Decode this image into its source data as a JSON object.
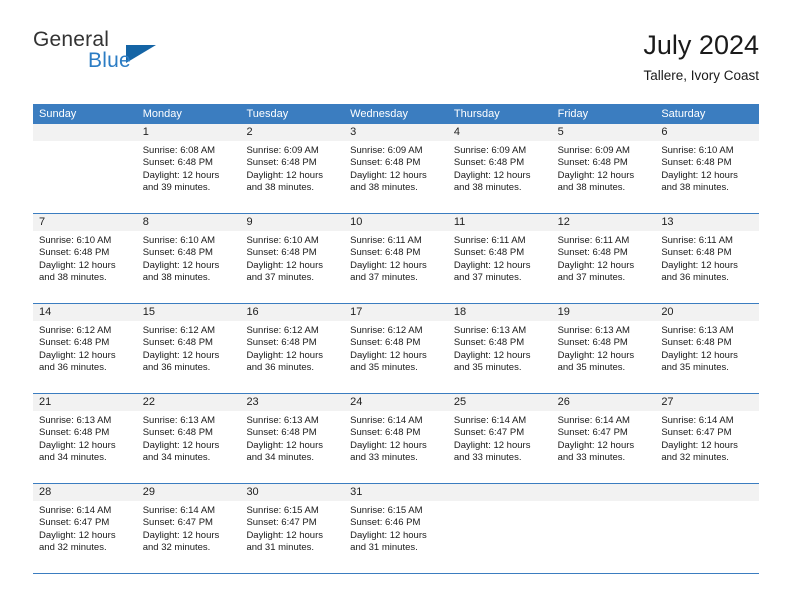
{
  "logo": {
    "word_top": "General",
    "word_bottom": "Blue",
    "triangle_icon": "logo-triangle-icon",
    "colors": {
      "general_text": "#333333",
      "blue_text": "#2b7cc4",
      "triangle": "#1464a5"
    }
  },
  "header": {
    "title": "July 2024",
    "subtitle": "Tallere, Ivory Coast"
  },
  "theme": {
    "header_blue": "#3b7dc0",
    "daynum_bg": "#f2f2f2",
    "cell_bg": "#ffffff"
  },
  "weekdays": [
    "Sunday",
    "Monday",
    "Tuesday",
    "Wednesday",
    "Thursday",
    "Friday",
    "Saturday"
  ],
  "weeks": [
    [
      {
        "day": "",
        "empty": true,
        "sunrise": "",
        "sunset": "",
        "daylight_1": "",
        "daylight_2": ""
      },
      {
        "day": "1",
        "sunrise": "Sunrise: 6:08 AM",
        "sunset": "Sunset: 6:48 PM",
        "daylight_1": "Daylight: 12 hours",
        "daylight_2": "and 39 minutes."
      },
      {
        "day": "2",
        "sunrise": "Sunrise: 6:09 AM",
        "sunset": "Sunset: 6:48 PM",
        "daylight_1": "Daylight: 12 hours",
        "daylight_2": "and 38 minutes."
      },
      {
        "day": "3",
        "sunrise": "Sunrise: 6:09 AM",
        "sunset": "Sunset: 6:48 PM",
        "daylight_1": "Daylight: 12 hours",
        "daylight_2": "and 38 minutes."
      },
      {
        "day": "4",
        "sunrise": "Sunrise: 6:09 AM",
        "sunset": "Sunset: 6:48 PM",
        "daylight_1": "Daylight: 12 hours",
        "daylight_2": "and 38 minutes."
      },
      {
        "day": "5",
        "sunrise": "Sunrise: 6:09 AM",
        "sunset": "Sunset: 6:48 PM",
        "daylight_1": "Daylight: 12 hours",
        "daylight_2": "and 38 minutes."
      },
      {
        "day": "6",
        "sunrise": "Sunrise: 6:10 AM",
        "sunset": "Sunset: 6:48 PM",
        "daylight_1": "Daylight: 12 hours",
        "daylight_2": "and 38 minutes."
      }
    ],
    [
      {
        "day": "7",
        "sunrise": "Sunrise: 6:10 AM",
        "sunset": "Sunset: 6:48 PM",
        "daylight_1": "Daylight: 12 hours",
        "daylight_2": "and 38 minutes."
      },
      {
        "day": "8",
        "sunrise": "Sunrise: 6:10 AM",
        "sunset": "Sunset: 6:48 PM",
        "daylight_1": "Daylight: 12 hours",
        "daylight_2": "and 38 minutes."
      },
      {
        "day": "9",
        "sunrise": "Sunrise: 6:10 AM",
        "sunset": "Sunset: 6:48 PM",
        "daylight_1": "Daylight: 12 hours",
        "daylight_2": "and 37 minutes."
      },
      {
        "day": "10",
        "sunrise": "Sunrise: 6:11 AM",
        "sunset": "Sunset: 6:48 PM",
        "daylight_1": "Daylight: 12 hours",
        "daylight_2": "and 37 minutes."
      },
      {
        "day": "11",
        "sunrise": "Sunrise: 6:11 AM",
        "sunset": "Sunset: 6:48 PM",
        "daylight_1": "Daylight: 12 hours",
        "daylight_2": "and 37 minutes."
      },
      {
        "day": "12",
        "sunrise": "Sunrise: 6:11 AM",
        "sunset": "Sunset: 6:48 PM",
        "daylight_1": "Daylight: 12 hours",
        "daylight_2": "and 37 minutes."
      },
      {
        "day": "13",
        "sunrise": "Sunrise: 6:11 AM",
        "sunset": "Sunset: 6:48 PM",
        "daylight_1": "Daylight: 12 hours",
        "daylight_2": "and 36 minutes."
      }
    ],
    [
      {
        "day": "14",
        "sunrise": "Sunrise: 6:12 AM",
        "sunset": "Sunset: 6:48 PM",
        "daylight_1": "Daylight: 12 hours",
        "daylight_2": "and 36 minutes."
      },
      {
        "day": "15",
        "sunrise": "Sunrise: 6:12 AM",
        "sunset": "Sunset: 6:48 PM",
        "daylight_1": "Daylight: 12 hours",
        "daylight_2": "and 36 minutes."
      },
      {
        "day": "16",
        "sunrise": "Sunrise: 6:12 AM",
        "sunset": "Sunset: 6:48 PM",
        "daylight_1": "Daylight: 12 hours",
        "daylight_2": "and 36 minutes."
      },
      {
        "day": "17",
        "sunrise": "Sunrise: 6:12 AM",
        "sunset": "Sunset: 6:48 PM",
        "daylight_1": "Daylight: 12 hours",
        "daylight_2": "and 35 minutes."
      },
      {
        "day": "18",
        "sunrise": "Sunrise: 6:13 AM",
        "sunset": "Sunset: 6:48 PM",
        "daylight_1": "Daylight: 12 hours",
        "daylight_2": "and 35 minutes."
      },
      {
        "day": "19",
        "sunrise": "Sunrise: 6:13 AM",
        "sunset": "Sunset: 6:48 PM",
        "daylight_1": "Daylight: 12 hours",
        "daylight_2": "and 35 minutes."
      },
      {
        "day": "20",
        "sunrise": "Sunrise: 6:13 AM",
        "sunset": "Sunset: 6:48 PM",
        "daylight_1": "Daylight: 12 hours",
        "daylight_2": "and 35 minutes."
      }
    ],
    [
      {
        "day": "21",
        "sunrise": "Sunrise: 6:13 AM",
        "sunset": "Sunset: 6:48 PM",
        "daylight_1": "Daylight: 12 hours",
        "daylight_2": "and 34 minutes."
      },
      {
        "day": "22",
        "sunrise": "Sunrise: 6:13 AM",
        "sunset": "Sunset: 6:48 PM",
        "daylight_1": "Daylight: 12 hours",
        "daylight_2": "and 34 minutes."
      },
      {
        "day": "23",
        "sunrise": "Sunrise: 6:13 AM",
        "sunset": "Sunset: 6:48 PM",
        "daylight_1": "Daylight: 12 hours",
        "daylight_2": "and 34 minutes."
      },
      {
        "day": "24",
        "sunrise": "Sunrise: 6:14 AM",
        "sunset": "Sunset: 6:48 PM",
        "daylight_1": "Daylight: 12 hours",
        "daylight_2": "and 33 minutes."
      },
      {
        "day": "25",
        "sunrise": "Sunrise: 6:14 AM",
        "sunset": "Sunset: 6:47 PM",
        "daylight_1": "Daylight: 12 hours",
        "daylight_2": "and 33 minutes."
      },
      {
        "day": "26",
        "sunrise": "Sunrise: 6:14 AM",
        "sunset": "Sunset: 6:47 PM",
        "daylight_1": "Daylight: 12 hours",
        "daylight_2": "and 33 minutes."
      },
      {
        "day": "27",
        "sunrise": "Sunrise: 6:14 AM",
        "sunset": "Sunset: 6:47 PM",
        "daylight_1": "Daylight: 12 hours",
        "daylight_2": "and 32 minutes."
      }
    ],
    [
      {
        "day": "28",
        "sunrise": "Sunrise: 6:14 AM",
        "sunset": "Sunset: 6:47 PM",
        "daylight_1": "Daylight: 12 hours",
        "daylight_2": "and 32 minutes."
      },
      {
        "day": "29",
        "sunrise": "Sunrise: 6:14 AM",
        "sunset": "Sunset: 6:47 PM",
        "daylight_1": "Daylight: 12 hours",
        "daylight_2": "and 32 minutes."
      },
      {
        "day": "30",
        "sunrise": "Sunrise: 6:15 AM",
        "sunset": "Sunset: 6:47 PM",
        "daylight_1": "Daylight: 12 hours",
        "daylight_2": "and 31 minutes."
      },
      {
        "day": "31",
        "sunrise": "Sunrise: 6:15 AM",
        "sunset": "Sunset: 6:46 PM",
        "daylight_1": "Daylight: 12 hours",
        "daylight_2": "and 31 minutes."
      },
      {
        "day": "",
        "empty": true,
        "sunrise": "",
        "sunset": "",
        "daylight_1": "",
        "daylight_2": ""
      },
      {
        "day": "",
        "empty": true,
        "sunrise": "",
        "sunset": "",
        "daylight_1": "",
        "daylight_2": ""
      },
      {
        "day": "",
        "empty": true,
        "sunrise": "",
        "sunset": "",
        "daylight_1": "",
        "daylight_2": ""
      }
    ]
  ]
}
